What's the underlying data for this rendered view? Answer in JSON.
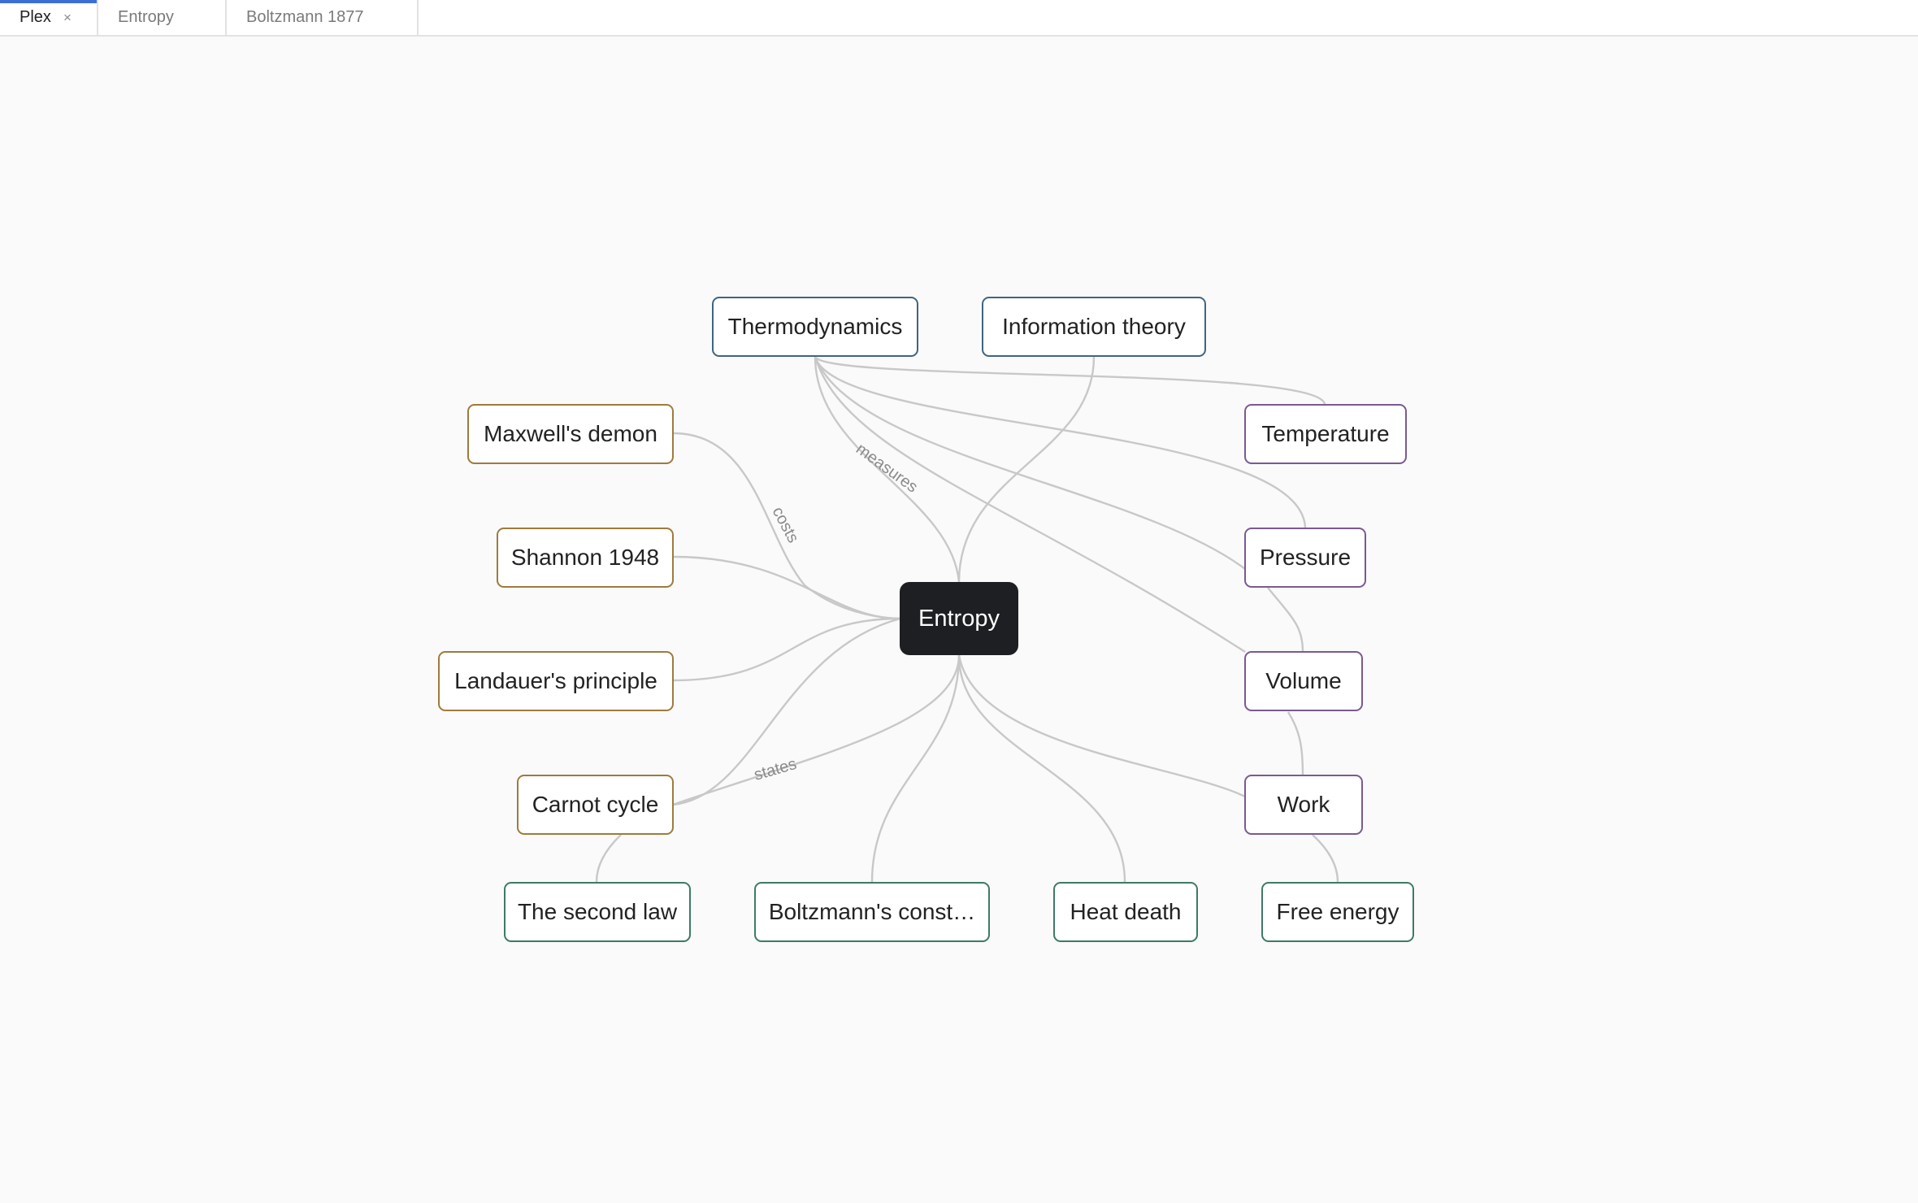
{
  "tabs": [
    {
      "label": "Plex",
      "close": "×"
    },
    {
      "label": "Entropy"
    },
    {
      "label": "Boltzmann 1877"
    }
  ],
  "graph": {
    "center": "Entropy",
    "nodes": {
      "thermodynamics": "Thermodynamics",
      "information_theory": "Information theory",
      "maxwells_demon": "Maxwell's demon",
      "shannon_1948": "Shannon 1948",
      "landauers_principle": "Landauer's principle",
      "carnot_cycle": "Carnot cycle",
      "temperature": "Temperature",
      "pressure": "Pressure",
      "volume": "Volume",
      "work": "Work",
      "the_second_law": "The second law",
      "boltzmanns_constant": "Boltzmann's const…",
      "heat_death": "Heat death",
      "free_energy": "Free energy"
    },
    "edge_labels": {
      "costs": "costs",
      "measures": "measures",
      "states": "states"
    },
    "colors": {
      "left_group": "#a07a3c",
      "top_group": "#3f6582",
      "right_group": "#7a5a92",
      "bottom_group": "#3e7a66",
      "center_fill": "#1e1f22",
      "edge": "#c8c8c8",
      "active_tab": "#3b6fd6"
    }
  }
}
